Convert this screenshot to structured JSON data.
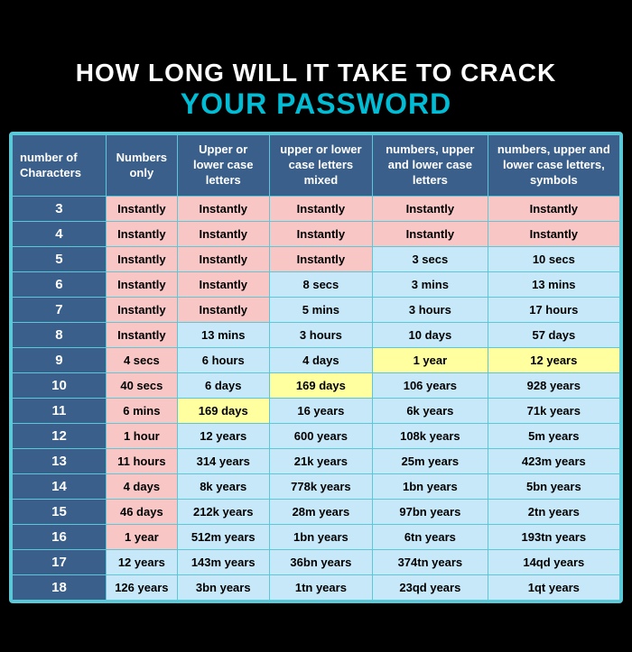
{
  "title": {
    "line1": "HOW LONG WILL IT TAKE TO CRACK",
    "line2": "YOUR PASSWORD"
  },
  "headers": {
    "col1": "number of Characters",
    "col2": "Numbers only",
    "col3": "Upper or lower case letters",
    "col4": "upper or lower case letters mixed",
    "col5": "numbers, upper and lower case letters",
    "col6": "numbers, upper and lower case letters, symbols"
  },
  "rows": [
    {
      "chars": "3",
      "num": "Instantly",
      "upper": "Instantly",
      "mixed": "Instantly",
      "numul": "Instantly",
      "all": "Instantly",
      "numC": "pink",
      "upperC": "pink",
      "mixedC": "pink",
      "numUlC": "pink",
      "allC": "pink"
    },
    {
      "chars": "4",
      "num": "Instantly",
      "upper": "Instantly",
      "mixed": "Instantly",
      "numul": "Instantly",
      "all": "Instantly",
      "numC": "pink",
      "upperC": "pink",
      "mixedC": "pink",
      "numUlC": "pink",
      "allC": "pink"
    },
    {
      "chars": "5",
      "num": "Instantly",
      "upper": "Instantly",
      "mixed": "Instantly",
      "numul": "3 secs",
      "all": "10 secs",
      "numC": "pink",
      "upperC": "pink",
      "mixedC": "pink",
      "numUlC": "blue",
      "allC": "blue"
    },
    {
      "chars": "6",
      "num": "Instantly",
      "upper": "Instantly",
      "mixed": "8 secs",
      "numul": "3 mins",
      "all": "13 mins",
      "numC": "pink",
      "upperC": "pink",
      "mixedC": "blue",
      "numUlC": "blue",
      "allC": "blue"
    },
    {
      "chars": "7",
      "num": "Instantly",
      "upper": "Instantly",
      "mixed": "5 mins",
      "numul": "3 hours",
      "all": "17 hours",
      "numC": "pink",
      "upperC": "pink",
      "mixedC": "blue",
      "numUlC": "blue",
      "allC": "blue"
    },
    {
      "chars": "8",
      "num": "Instantly",
      "upper": "13 mins",
      "mixed": "3 hours",
      "numul": "10 days",
      "all": "57 days",
      "numC": "pink",
      "upperC": "blue",
      "mixedC": "blue",
      "numUlC": "blue",
      "allC": "blue"
    },
    {
      "chars": "9",
      "num": "4 secs",
      "upper": "6 hours",
      "mixed": "4 days",
      "numul": "1 year",
      "all": "12 years",
      "numC": "pink",
      "upperC": "blue",
      "mixedC": "blue",
      "numUlC": "yellow",
      "allC": "yellow"
    },
    {
      "chars": "10",
      "num": "40 secs",
      "upper": "6 days",
      "mixed": "169 days",
      "numul": "106 years",
      "all": "928 years",
      "numC": "pink",
      "upperC": "blue",
      "mixedC": "yellow",
      "numUlC": "blue",
      "allC": "blue"
    },
    {
      "chars": "11",
      "num": "6 mins",
      "upper": "169 days",
      "mixed": "16 years",
      "numul": "6k years",
      "all": "71k years",
      "numC": "pink",
      "upperC": "yellow",
      "mixedC": "blue",
      "numUlC": "blue",
      "allC": "blue"
    },
    {
      "chars": "12",
      "num": "1 hour",
      "upper": "12 years",
      "mixed": "600 years",
      "numul": "108k years",
      "all": "5m years",
      "numC": "pink",
      "upperC": "blue",
      "mixedC": "blue",
      "numUlC": "blue",
      "allC": "blue"
    },
    {
      "chars": "13",
      "num": "11 hours",
      "upper": "314 years",
      "mixed": "21k years",
      "numul": "25m years",
      "all": "423m years",
      "numC": "pink",
      "upperC": "blue",
      "mixedC": "blue",
      "numUlC": "blue",
      "allC": "blue"
    },
    {
      "chars": "14",
      "num": "4 days",
      "upper": "8k years",
      "mixed": "778k years",
      "numul": "1bn years",
      "all": "5bn years",
      "numC": "pink",
      "upperC": "blue",
      "mixedC": "blue",
      "numUlC": "blue",
      "allC": "blue"
    },
    {
      "chars": "15",
      "num": "46 days",
      "upper": "212k years",
      "mixed": "28m years",
      "numul": "97bn years",
      "all": "2tn years",
      "numC": "pink",
      "upperC": "blue",
      "mixedC": "blue",
      "numUlC": "blue",
      "allC": "blue"
    },
    {
      "chars": "16",
      "num": "1 year",
      "upper": "512m years",
      "mixed": "1bn years",
      "numul": "6tn years",
      "all": "193tn years",
      "numC": "pink",
      "upperC": "blue",
      "mixedC": "blue",
      "numUlC": "blue",
      "allC": "blue"
    },
    {
      "chars": "17",
      "num": "12 years",
      "upper": "143m years",
      "mixed": "36bn years",
      "numul": "374tn years",
      "all": "14qd years",
      "numC": "blue",
      "upperC": "blue",
      "mixedC": "blue",
      "numUlC": "blue",
      "allC": "blue"
    },
    {
      "chars": "18",
      "num": "126 years",
      "upper": "3bn years",
      "mixed": "1tn years",
      "numul": "23qd years",
      "all": "1qt years",
      "numC": "blue",
      "upperC": "blue",
      "mixedC": "blue",
      "numUlC": "blue",
      "allC": "blue"
    }
  ]
}
